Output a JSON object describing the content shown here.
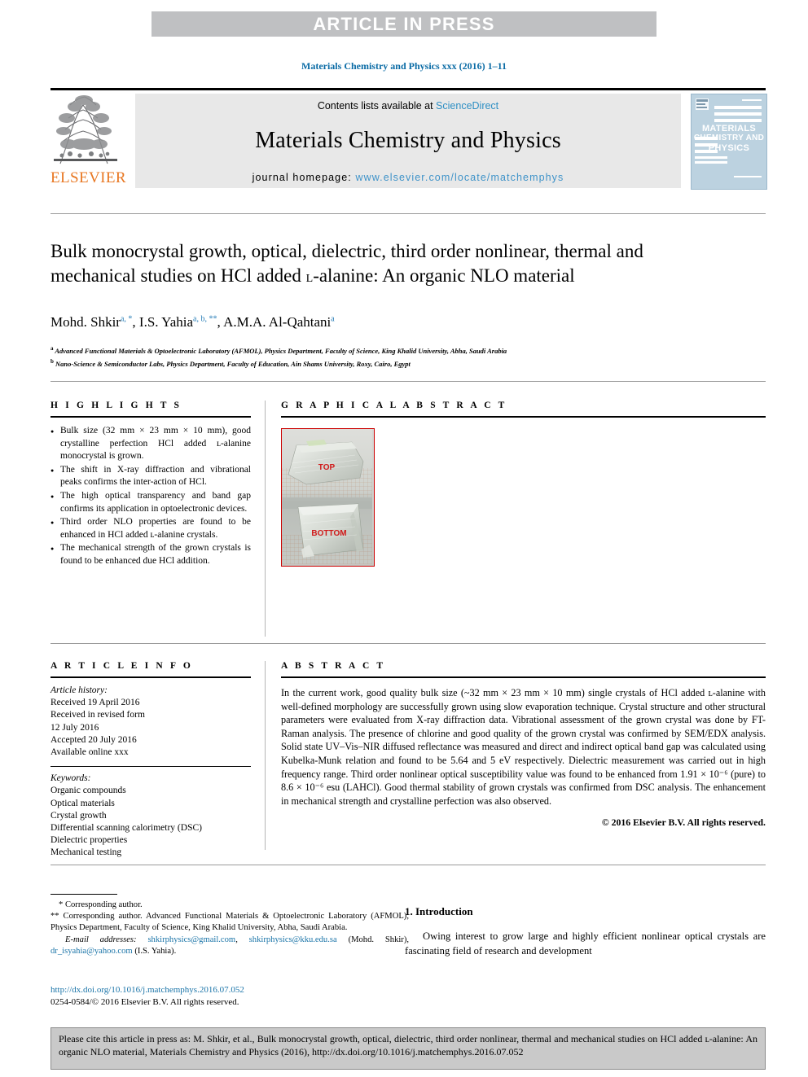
{
  "banner": {
    "label": "ARTICLE IN PRESS"
  },
  "running_head": {
    "text": "Materials Chemistry and Physics xxx (2016) 1–11",
    "color": "#0a6ba5"
  },
  "masthead": {
    "contents_prefix": "Contents lists available at ",
    "sciencedirect": "ScienceDirect",
    "journal_title": "Materials Chemistry and Physics",
    "homepage_prefix": "journal homepage: ",
    "homepage_url": "www.elsevier.com/locate/matchemphys",
    "publisher": "ELSEVIER",
    "cover": {
      "line1": "MATERIALS",
      "line2": "CHEMISTRY AND",
      "line3": "PHYSICS"
    }
  },
  "article": {
    "title_part1": "Bulk monocrystal growth, optical, dielectric, third order nonlinear, thermal and mechanical studies on HCl added ",
    "title_smallcap": "l",
    "title_part2": "-alanine: An organic NLO material",
    "authors": [
      {
        "name": "Mohd. Shkir",
        "marks": "a, *"
      },
      {
        "name": "I.S. Yahia",
        "marks": "a, b, **"
      },
      {
        "name": "A.M.A. Al-Qahtani",
        "marks": "a"
      }
    ],
    "affiliations": [
      {
        "mark": "a",
        "text": "Advanced Functional Materials & Optoelectronic Laboratory (AFMOL), Physics Department, Faculty of Science, King Khalid University, Abha, Saudi Arabia"
      },
      {
        "mark": "b",
        "text": "Nano-Science & Semiconductor Labs, Physics Department, Faculty of Education, Ain Shams University, Roxy, Cairo, Egypt"
      }
    ]
  },
  "highlights": {
    "heading": "H I G H L I G H T S",
    "items": [
      "Bulk size (32 mm × 23 mm × 10 mm), good crystalline perfection HCl added ʟ-alanine monocrystal is grown.",
      "The shift in X-ray diffraction and vibrational peaks confirms the inter-action of HCl.",
      "The high optical transparency and band gap confirms its application in optoelectronic devices.",
      "Third order NLO properties are found to be enhanced in HCl added ʟ-alanine crystals.",
      "The mechanical strength of the grown crystals is found to be enhanced due HCl addition."
    ]
  },
  "graphical_abstract": {
    "heading": "G R A P H I C A L   A B S T R A C T",
    "image_labels": {
      "top": "TOP",
      "bottom": "BOTTOM"
    }
  },
  "article_info": {
    "heading": "A R T I C L E   I N F O",
    "history_label": "Article history:",
    "history": [
      "Received 19 April 2016",
      "Received in revised form",
      "12 July 2016",
      "Accepted 20 July 2016",
      "Available online xxx"
    ],
    "keywords_label": "Keywords:",
    "keywords": [
      "Organic compounds",
      "Optical materials",
      "Crystal growth",
      "Differential scanning calorimetry (DSC)",
      "Dielectric properties",
      "Mechanical testing"
    ]
  },
  "abstract": {
    "heading": "A B S T R A C T",
    "text": "In the current work, good quality bulk size (~32 mm × 23 mm × 10 mm) single crystals of HCl added ʟ-alanine with well-defined morphology are successfully grown using slow evaporation technique. Crystal structure and other structural parameters were evaluated from X-ray diffraction data. Vibrational assessment of the grown crystal was done by FT-Raman analysis. The presence of chlorine and good quality of the grown crystal was confirmed by SEM/EDX analysis. Solid state UV–Vis–NIR diffused reflectance was measured and direct and indirect optical band gap was calculated using Kubelka-Munk relation and found to be 5.64 and 5 eV respectively. Dielectric measurement was carried out in high frequency range. Third order nonlinear optical susceptibility value was found to be enhanced from 1.91 × 10⁻⁶ (pure) to 8.6 × 10⁻⁶ esu (LAHCl). Good thermal stability of grown crystals was confirmed from DSC analysis. The enhancement in mechanical strength and crystalline perfection was also observed.",
    "copyright": "© 2016 Elsevier B.V. All rights reserved."
  },
  "footnotes": {
    "corr1": "* Corresponding author.",
    "corr2": "** Corresponding author. Advanced Functional Materials & Optoelectronic Laboratory (AFMOL), Physics Department, Faculty of Science, King Khalid University, Abha, Saudi Arabia.",
    "email_label": "E-mail addresses:",
    "email1": "shkirphysics@gmail.com",
    "email2": "shkirphysics@kku.edu.sa",
    "email_name1": "(Mohd. Shkir),",
    "email3": "dr_isyahia@yahoo.com",
    "email_name2": "(I.S. Yahia)."
  },
  "doi": {
    "url": "http://dx.doi.org/10.1016/j.matchemphys.2016.07.052",
    "issn_line": "0254-0584/© 2016 Elsevier B.V. All rights reserved."
  },
  "introduction": {
    "heading": "1. Introduction",
    "paragraph": "Owing interest to grow large and highly efficient nonlinear optical crystals are fascinating field of research and development"
  },
  "citation": {
    "text": "Please cite this article in press as: M. Shkir, et al., Bulk monocrystal growth, optical, dielectric, third order nonlinear, thermal and mechanical studies on HCl added ʟ-alanine: An organic NLO material, Materials Chemistry and Physics (2016), http://dx.doi.org/10.1016/j.matchemphys.2016.07.052"
  }
}
